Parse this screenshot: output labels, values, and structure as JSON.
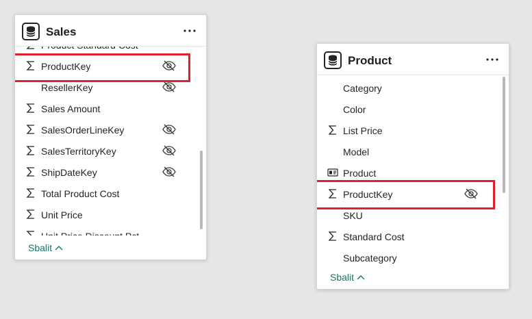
{
  "sales": {
    "title": "Sales",
    "fields": [
      {
        "label": "Product Standard Cost",
        "sum": true,
        "hidden": false
      },
      {
        "label": "ProductKey",
        "sum": true,
        "hidden": true
      },
      {
        "label": "ResellerKey",
        "sum": false,
        "hidden": true
      },
      {
        "label": "Sales Amount",
        "sum": true,
        "hidden": false
      },
      {
        "label": "SalesOrderLineKey",
        "sum": true,
        "hidden": true
      },
      {
        "label": "SalesTerritoryKey",
        "sum": true,
        "hidden": true
      },
      {
        "label": "ShipDateKey",
        "sum": true,
        "hidden": true
      },
      {
        "label": "Total Product Cost",
        "sum": true,
        "hidden": false
      },
      {
        "label": "Unit Price",
        "sum": true,
        "hidden": false
      },
      {
        "label": "Unit Price Discount Pct",
        "sum": true,
        "hidden": false
      }
    ],
    "collapse_label": "Sbalit"
  },
  "product": {
    "title": "Product",
    "fields": [
      {
        "label": "Category",
        "sum": false,
        "hidden": false
      },
      {
        "label": "Color",
        "sum": false,
        "hidden": false
      },
      {
        "label": "List Price",
        "sum": true,
        "hidden": false
      },
      {
        "label": "Model",
        "sum": false,
        "hidden": false
      },
      {
        "label": "Product",
        "sum": false,
        "hidden": false,
        "card": true
      },
      {
        "label": "ProductKey",
        "sum": true,
        "hidden": true
      },
      {
        "label": "SKU",
        "sum": false,
        "hidden": false
      },
      {
        "label": "Standard Cost",
        "sum": true,
        "hidden": false
      },
      {
        "label": "Subcategory",
        "sum": false,
        "hidden": false
      }
    ],
    "collapse_label": "Sbalit"
  },
  "colors": {
    "highlight": "#e0202d",
    "link": "#117865",
    "text": "#252423"
  },
  "icons": {
    "table": "table-icon",
    "sum": "sigma-icon",
    "hidden": "eye-off-icon",
    "more": "more-options-icon",
    "collapse": "chevron-up-icon",
    "card": "id-card-icon"
  }
}
